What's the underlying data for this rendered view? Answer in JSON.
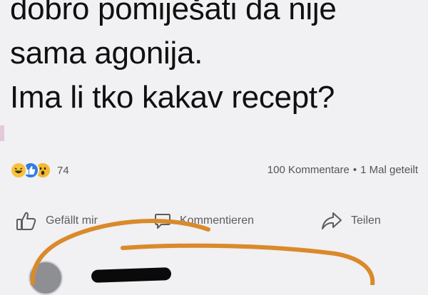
{
  "post": {
    "lines": [
      "dobro pomiješati da nije",
      "sama agonija.",
      "Ima li tko kakav recept?"
    ]
  },
  "stats": {
    "reactions": [
      "haha-reaction-icon",
      "like-reaction-icon",
      "wow-reaction-icon"
    ],
    "reaction_count": "74",
    "comments": "100 Kommentare",
    "separator": "•",
    "shares": "1 Mal geteilt"
  },
  "actions": {
    "like_label": "Gefällt mir",
    "comment_label": "Kommentieren",
    "share_label": "Teilen",
    "icons": [
      "thumbs-up-icon",
      "comment-bubble-icon",
      "share-arrow-icon"
    ]
  },
  "colors": {
    "background": "#f1f0f2",
    "text": "#101010",
    "muted": "#5a5d62",
    "like_blue": "#2f7de1",
    "emoji_yellow": "#f7c23a",
    "scribble_orange": "#d98a2b"
  }
}
